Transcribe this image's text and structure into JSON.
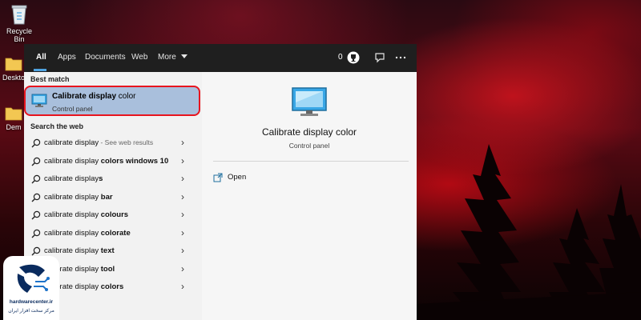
{
  "desktop": {
    "icons": [
      {
        "label": "Recycle Bin"
      },
      {
        "label": "Deskto"
      },
      {
        "label": "Dem"
      }
    ]
  },
  "search": {
    "tabs": [
      {
        "label": "All"
      },
      {
        "label": "Apps"
      },
      {
        "label": "Documents"
      },
      {
        "label": "Web"
      },
      {
        "label": "More"
      }
    ],
    "points": "0",
    "best_match_heading": "Best match",
    "best_match": {
      "title_bold": "Calibrate display",
      "title_rest": " color",
      "subtitle": "Control panel"
    },
    "web_heading": "Search the web",
    "suggestions": [
      {
        "prefix": "calibrate display",
        "bold": "",
        "suffix": " - See web results"
      },
      {
        "prefix": "calibrate display ",
        "bold": "colors windows 10",
        "suffix": ""
      },
      {
        "prefix": "calibrate display",
        "bold": "s",
        "suffix": ""
      },
      {
        "prefix": "calibrate display ",
        "bold": "bar",
        "suffix": ""
      },
      {
        "prefix": "calibrate display ",
        "bold": "colours",
        "suffix": ""
      },
      {
        "prefix": "calibrate display ",
        "bold": "colorate",
        "suffix": ""
      },
      {
        "prefix": "calibrate display ",
        "bold": "text",
        "suffix": ""
      },
      {
        "prefix": "calibrate display ",
        "bold": "tool",
        "suffix": ""
      },
      {
        "prefix": "calibrate display ",
        "bold": "colors",
        "suffix": ""
      }
    ],
    "detail": {
      "title": "Calibrate display color",
      "subtitle": "Control panel",
      "action_open": "Open"
    }
  },
  "watermark": {
    "brand": "hardwarecenter.ir",
    "tagline": "مرکز سخت افزار ایران"
  },
  "colors": {
    "accent": "#4fa3e0",
    "highlight_border": "#e8141e",
    "selected_bg": "#a9bfdc"
  }
}
